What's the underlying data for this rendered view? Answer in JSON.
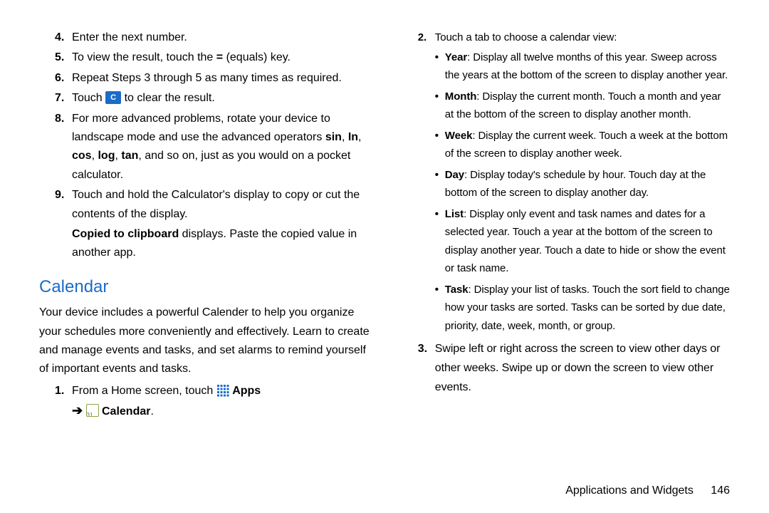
{
  "left": {
    "steps": [
      {
        "n": "4.",
        "text": "Enter the next number."
      },
      {
        "n": "5.",
        "pre": "To view the result, touch the ",
        "bold": "=",
        "post": " (equals) key."
      },
      {
        "n": "6.",
        "text": "Repeat Steps 3 through 5 as many times as required."
      },
      {
        "n": "7.",
        "pre": "Touch ",
        "key": "C",
        "post": " to clear the result."
      },
      {
        "n": "8.",
        "pre": "For more advanced problems, rotate your device to landscape mode and use the advanced operators ",
        "b1": "sin",
        "mid1": ", ",
        "b2": "In",
        "mid2": ", ",
        "b3": "cos",
        "mid3": ", ",
        "b4": "log",
        "mid4": ", ",
        "b5": "tan",
        "post": ", and so on, just as you would on a pocket calculator."
      },
      {
        "n": "9.",
        "text": "Touch and hold the Calculator's display to copy or cut the contents of the display.",
        "sub_bold": "Copied to clipboard",
        "sub_rest": " displays. Paste the copied value in another app."
      }
    ],
    "heading": "Calendar",
    "intro": "Your device includes a powerful Calender to help you organize your schedules more conveniently and effectively. Learn to create and manage events and tasks, and set alarms to remind yourself of important events and tasks.",
    "cal_step_n": "1.",
    "cal_step_pre": "From a Home screen, touch ",
    "cal_apps": "Apps",
    "cal_arrow": "➔",
    "cal_label": "Calendar",
    "cal_dot": "."
  },
  "right": {
    "step2_n": "2.",
    "step2_text": "Touch a tab to choose a calendar view:",
    "views": [
      {
        "b": "Year",
        "t": ": Display all twelve months of this year. Sweep across the years at the bottom of the screen to display another year."
      },
      {
        "b": "Month",
        "t": ": Display the current month. Touch a month and year at the bottom of the screen to display another month."
      },
      {
        "b": "Week",
        "t": ": Display the current week. Touch a week at the bottom of the screen to display another week."
      },
      {
        "b": "Day",
        "t": ": Display today's schedule by hour. Touch day at the bottom of the screen to display another day."
      },
      {
        "b": "List",
        "t": ": Display only event and task names and dates for a selected year. Touch a year at the bottom of the screen to display another year. Touch a date to hide or show the event or task name."
      },
      {
        "b": "Task",
        "t": ": Display your list of tasks. Touch the sort field to change how your tasks are sorted. Tasks can be sorted by due date, priority, date, week, month, or group."
      }
    ],
    "step3_n": "3.",
    "step3_text": "Swipe left or right across the screen to view other days or other weeks. Swipe up or down the screen to view other events."
  },
  "footer": {
    "section": "Applications and Widgets",
    "page": "146"
  }
}
